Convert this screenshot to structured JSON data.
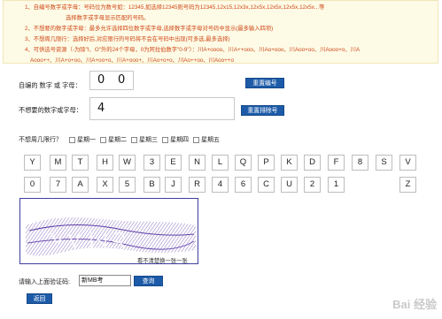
{
  "notice": {
    "lines": [
      "1、自编号数字或字母：号码位为数号如：12345,如选择12345则号码为12345,12x15,12x3x,12x5x,12x5x,12x5x,12x5x...等",
      "选择数字或字母显示匹配的号码。",
      "2、不想要的数字或字母：最多允许选择四位数字或字母,选择数字或字母对号码中显示(最多输入四项)",
      "3、不想周几限行：选择好后,对应限行的号码将不会在号码中出现(可多选,最多选择)",
      "4、可供选号资源（-为除\"I、O\"外的24个字母，0为阿拉伯数字\"0-9\"）：川A+oooo、川A++ooo、川Ao+ooo、川Aoo+oo、川Aooo+o、川A",
      "Aooo++、川A+o+oo、川A+oo+o、川A+ooo+、川Ao+o+o、川Ao++oo、川Aoo++o"
    ]
  },
  "custom_number": {
    "label": "自编的 数字 或 字母：",
    "chars": [
      "0",
      "0"
    ],
    "reset_button": "重置编号"
  },
  "unwanted": {
    "label": "不想要的数字或字母：",
    "chars": [
      "4"
    ],
    "reset_button": "重置排除号"
  },
  "restriction": {
    "label": "不想周几限行？",
    "days": [
      "星期一",
      "星期二",
      "星期三",
      "星期四",
      "星期五"
    ]
  },
  "keyboard": {
    "row1": [
      "Y",
      "M",
      "T",
      "H",
      "W",
      "3",
      "E",
      "N",
      "L",
      "Q",
      "P",
      "K",
      "D",
      "F",
      "8",
      "S",
      "V"
    ],
    "row2": [
      "0",
      "7",
      "A",
      "X",
      "5",
      "B",
      "J",
      "R",
      "4",
      "6",
      "C",
      "U",
      "2",
      "1",
      "Z"
    ]
  },
  "captcha": {
    "hint": "看不清楚换一张一张"
  },
  "verification": {
    "label": "请输入上面验证码:",
    "value": "新MB考",
    "query_button": "查询"
  },
  "back_button": "返回",
  "watermark": "Bai 经验"
}
